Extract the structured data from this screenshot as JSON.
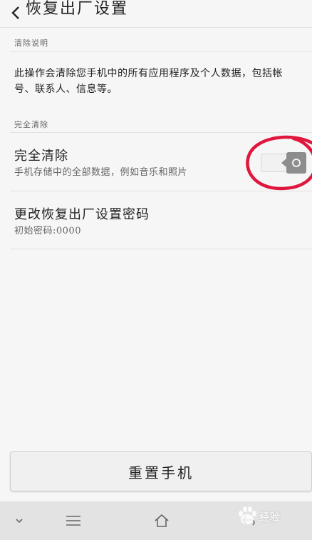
{
  "header": {
    "title": "恢复出厂设置",
    "back_icon": "chevron-left-icon"
  },
  "clear_description": {
    "section_label": "清除说明",
    "text": "此操作会清除您手机中的所有应用程序及个人数据，包括帐号、联系人、信息等。"
  },
  "full_clear": {
    "section_label": "完全清除",
    "title": "完全清除",
    "subtitle": "手机存储中的全部数据，例如音乐和照片",
    "toggle_on": false
  },
  "password": {
    "title": "更改恢复出厂设置密码",
    "subtitle": "初始密码:0000"
  },
  "reset_button": {
    "label": "重置手机"
  },
  "navbar": {
    "items": [
      "chevron-down-icon",
      "menu-icon",
      "home-icon",
      "back-icon"
    ]
  },
  "watermark": {
    "text": "经验"
  },
  "colors": {
    "background": "#f6f6f6",
    "annotation": "#e0163c",
    "toggle_knob": "#8d8d8d",
    "navbar": "#e3e3e3"
  }
}
